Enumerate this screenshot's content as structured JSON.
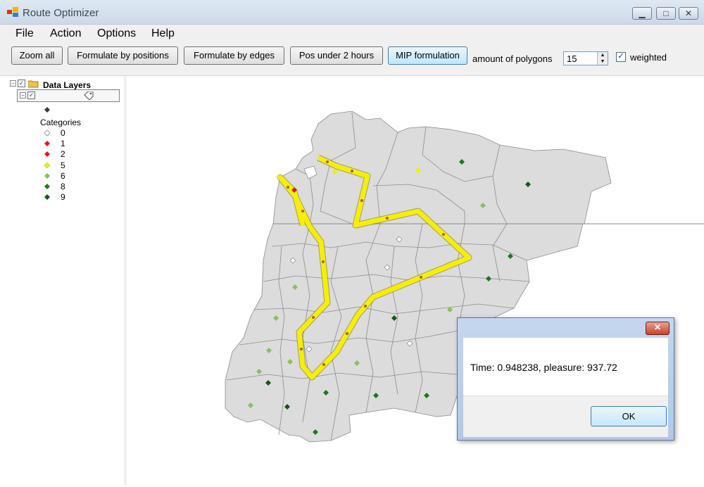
{
  "window": {
    "title": "Route Optimizer"
  },
  "menu": [
    "File",
    "Action",
    "Options",
    "Help"
  ],
  "toolbar": {
    "buttons": [
      "Zoom all",
      "Formulate by positions",
      "Formulate by edges",
      "Pos under 2 hours",
      "MIP formulation"
    ],
    "polygons_label": "amount of polygons",
    "polygons_value": "15",
    "weighted_label": "weighted",
    "weighted_checked": true
  },
  "layers": {
    "root_label": "Data Layers",
    "categories_label": "Categories",
    "categories": [
      {
        "label": "0",
        "color": "#ffffff"
      },
      {
        "label": "1",
        "color": "#e8141c"
      },
      {
        "label": "2",
        "color": "#e8141c"
      },
      {
        "label": "5",
        "color": "#f0f000"
      },
      {
        "label": "6",
        "color": "#86c25a"
      },
      {
        "label": "8",
        "color": "#1a7a1a"
      },
      {
        "label": "9",
        "color": "#0f5a0f"
      }
    ]
  },
  "dialog": {
    "message": "Time: 0.948238, pleasure: 937.72",
    "ok_label": "OK"
  },
  "colors": {
    "route": "#f6f000",
    "region_fill": "#dcdcdc",
    "region_stroke": "#8c8c8c"
  }
}
